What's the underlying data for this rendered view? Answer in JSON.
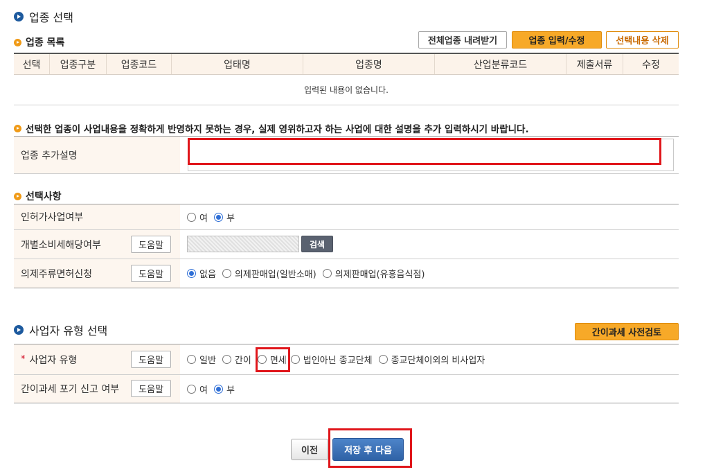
{
  "section_title": "업종 선택",
  "industry_list": {
    "title": "업종 목록",
    "buttons": {
      "download_all": "전체업종 내려받기",
      "input_edit": "업종 입력/수정",
      "delete_selected": "선택내용 삭제"
    },
    "columns": [
      "선택",
      "업종구분",
      "업종코드",
      "업태명",
      "업종명",
      "산업분류코드",
      "제출서류",
      "수정"
    ],
    "empty_message": "입력된 내용이 없습니다."
  },
  "additional": {
    "notice": "선택한 업종이 사업내용을 정확하게 반영하지 못하는 경우, 실제 영위하고자 하는 사업에 대한 설명을 추가 입력하시기 바랍니다.",
    "label": "업종 추가설명",
    "value": ""
  },
  "options": {
    "title": "선택사항",
    "help_label": "도움말",
    "license": {
      "label": "인허가사업여부",
      "choices": [
        "여",
        "부"
      ],
      "selected": "부"
    },
    "excise": {
      "label": "개별소비세해당여부",
      "search_label": "검색"
    },
    "liquor": {
      "label": "의제주류면허신청",
      "choices": [
        "없음",
        "의제판매업(일반소매)",
        "의제판매업(유흥음식점)"
      ],
      "selected": "없음"
    }
  },
  "biz_type": {
    "title": "사업자 유형 선택",
    "precheck_label": "간이과세 사전검토",
    "type_row": {
      "required_mark": "*",
      "label": "사업자 유형",
      "choices": [
        "일반",
        "간이",
        "면세",
        "법인아닌 종교단체",
        "종교단체이외의 비사업자"
      ],
      "selected": ""
    },
    "abandon_row": {
      "label": "간이과세 포기 신고 여부",
      "choices": [
        "여",
        "부"
      ],
      "selected": "부"
    }
  },
  "footer": {
    "prev_label": "이전",
    "next_label": "저장 후 다음"
  },
  "colors": {
    "accent_orange": "#f7a928",
    "primary_blue": "#2f62a6",
    "highlight_red": "#e0161b"
  }
}
